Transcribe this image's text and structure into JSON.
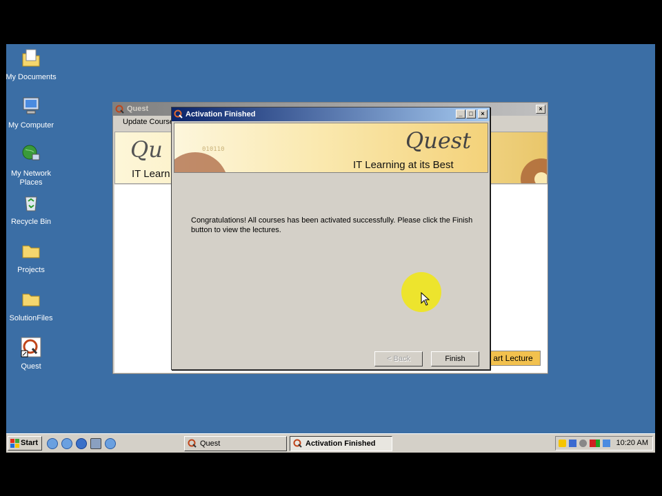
{
  "desktop_icons": [
    {
      "label": "My Documents",
      "icon": "my-documents-icon"
    },
    {
      "label": "My Computer",
      "icon": "my-computer-icon"
    },
    {
      "label": "My Network Places",
      "icon": "network-places-icon"
    },
    {
      "label": "Recycle Bin",
      "icon": "recycle-bin-icon"
    },
    {
      "label": "Projects",
      "icon": "folder-icon"
    },
    {
      "label": "SolutionFiles",
      "icon": "folder-icon"
    },
    {
      "label": "Quest",
      "icon": "quest-shortcut-icon"
    }
  ],
  "quest_window": {
    "title": "Quest",
    "menu_update": "Update Course",
    "logo_partial": "Qu",
    "tagline_partial": "IT Learn",
    "start_lecture": "art Lecture"
  },
  "dialog": {
    "title": "Activation Finished",
    "logo_text": "Quest",
    "tagline": "IT Learning at its Best",
    "message": "Congratulations! All courses has been activated successfully. Please click the Finish button to view the lectures.",
    "back_label": "< Back",
    "finish_label": "Finish",
    "title_controls": [
      "_",
      "□",
      "×"
    ]
  },
  "taskbar": {
    "start_label": "Start",
    "tasks": [
      {
        "label": "Quest",
        "active": false
      },
      {
        "label": "Activation Finished",
        "active": true
      }
    ],
    "clock": "10:20 AM"
  },
  "colors": {
    "desktop": "#3b6ea5",
    "title_active": "#0a246a",
    "highlight": "#f0e61c"
  }
}
